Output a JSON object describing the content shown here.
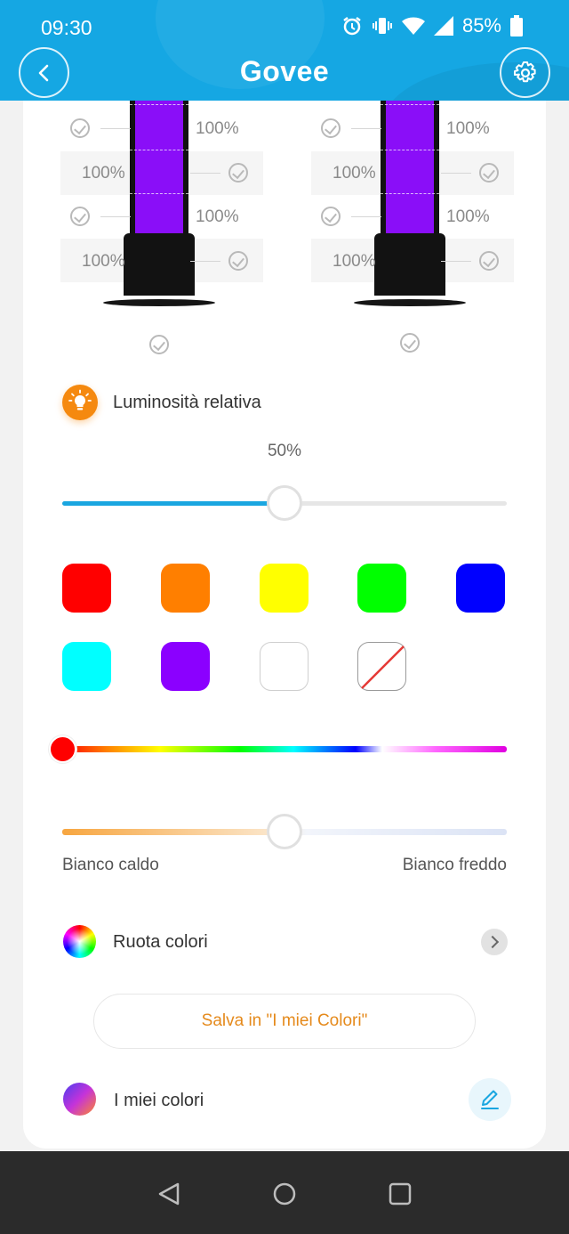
{
  "status_bar": {
    "time": "09:30",
    "battery": "85%",
    "icons": [
      "alarm-icon",
      "vibrate-icon",
      "wifi-icon",
      "signal-icon",
      "battery-icon"
    ]
  },
  "header": {
    "logo": "Govee",
    "back_icon": "chevron-left-icon",
    "settings_icon": "gear-icon",
    "background_color": "#15a7e3"
  },
  "lights": [
    {
      "segments": [
        "100%",
        "100%",
        "100%",
        "100%"
      ],
      "color": "#8a0ef8"
    },
    {
      "segments": [
        "100%",
        "100%",
        "100%",
        "100%"
      ],
      "color": "#8a0ef8"
    }
  ],
  "brightness": {
    "label": "Luminosità relativa",
    "value_text": "50%",
    "value": 0.5,
    "icon": "bulb-icon"
  },
  "swatches": [
    {
      "name": "red",
      "color": "#ff0000"
    },
    {
      "name": "orange",
      "color": "#ff7f00"
    },
    {
      "name": "yellow",
      "color": "#ffff00"
    },
    {
      "name": "green",
      "color": "#00ff00"
    },
    {
      "name": "blue",
      "color": "#0000ff"
    },
    {
      "name": "cyan",
      "color": "#00ffff"
    },
    {
      "name": "purple",
      "color": "#8b00ff"
    },
    {
      "name": "white",
      "color": "#ffffff"
    },
    {
      "name": "none",
      "color": "none"
    }
  ],
  "hue_slider": {
    "value": 0.0,
    "thumb_color": "#ff0000"
  },
  "white_slider": {
    "value": 0.5,
    "warm_label": "Bianco caldo",
    "cold_label": "Bianco freddo"
  },
  "color_wheel": {
    "label": "Ruota colori",
    "icon": "color-wheel-icon"
  },
  "save_button": {
    "label": "Salva in \"I miei Colori\""
  },
  "my_colors": {
    "label": "I miei colori",
    "icon": "gradient-circle-icon",
    "edit_icon": "pencil-icon"
  },
  "system_nav": {
    "icons": [
      "back-triangle-icon",
      "home-circle-icon",
      "recents-square-icon"
    ]
  }
}
